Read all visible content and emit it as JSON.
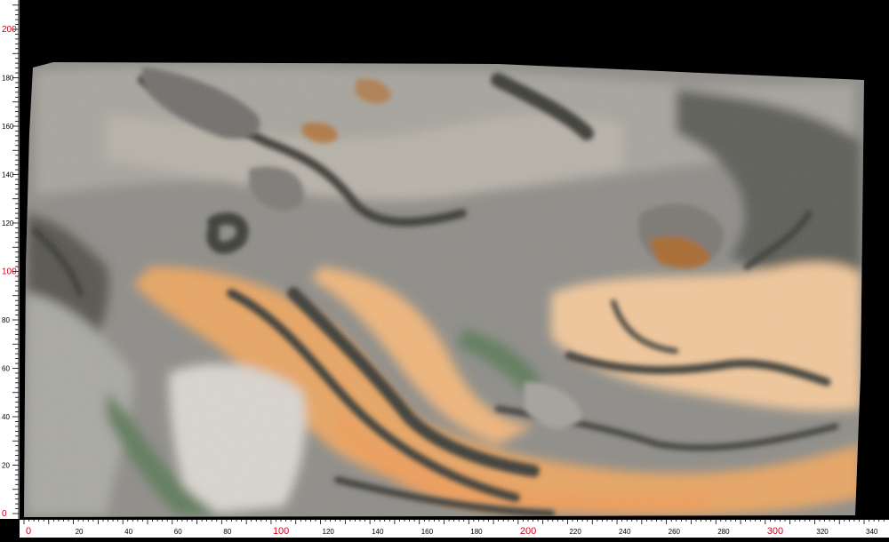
{
  "rulers": {
    "unit": "cm",
    "left": {
      "ticks": [
        {
          "v": 0,
          "label": "0",
          "color": "#d0021b"
        },
        {
          "v": 20,
          "label": "20",
          "color": "#000000"
        },
        {
          "v": 40,
          "label": "40",
          "color": "#000000"
        },
        {
          "v": 60,
          "label": "60",
          "color": "#000000"
        },
        {
          "v": 80,
          "label": "80",
          "color": "#000000"
        },
        {
          "v": 100,
          "label": "100",
          "color": "#d0021b"
        },
        {
          "v": 120,
          "label": "120",
          "color": "#000000"
        },
        {
          "v": 140,
          "label": "140",
          "color": "#000000"
        },
        {
          "v": 160,
          "label": "160",
          "color": "#000000"
        },
        {
          "v": 180,
          "label": "180",
          "color": "#000000"
        },
        {
          "v": 200,
          "label": "200",
          "color": "#d0021b"
        }
      ],
      "min": 0,
      "max": 210
    },
    "bottom": {
      "ticks": [
        {
          "v": 0,
          "label": "0",
          "color": "#d0021b"
        },
        {
          "v": 20,
          "label": "20",
          "color": "#000000"
        },
        {
          "v": 40,
          "label": "40",
          "color": "#000000"
        },
        {
          "v": 60,
          "label": "60",
          "color": "#000000"
        },
        {
          "v": 80,
          "label": "80",
          "color": "#000000"
        },
        {
          "v": 100,
          "label": "100",
          "color": "#d0021b"
        },
        {
          "v": 120,
          "label": "120",
          "color": "#000000"
        },
        {
          "v": 140,
          "label": "140",
          "color": "#000000"
        },
        {
          "v": 160,
          "label": "160",
          "color": "#000000"
        },
        {
          "v": 180,
          "label": "180",
          "color": "#000000"
        },
        {
          "v": 200,
          "label": "200",
          "color": "#d0021b"
        },
        {
          "v": 220,
          "label": "220",
          "color": "#000000"
        },
        {
          "v": 240,
          "label": "240",
          "color": "#000000"
        },
        {
          "v": 260,
          "label": "260",
          "color": "#000000"
        },
        {
          "v": 280,
          "label": "280",
          "color": "#000000"
        },
        {
          "v": 300,
          "label": "300",
          "color": "#d0021b"
        },
        {
          "v": 320,
          "label": "320",
          "color": "#000000"
        },
        {
          "v": 340,
          "label": "340",
          "color": "#000000"
        }
      ],
      "min": 0,
      "max": 355
    }
  },
  "slab": {
    "material": "marble slab",
    "colors": {
      "base_grey": "#8e8c87",
      "light_grey": "#bdb9b1",
      "dark_vein": "#3a3a36",
      "orange_band": "#e9a562",
      "peach": "#f2c79a",
      "rust": "#b5651d",
      "green_vein": "#5f7a5c",
      "white_patch": "#d9d6cf"
    }
  }
}
